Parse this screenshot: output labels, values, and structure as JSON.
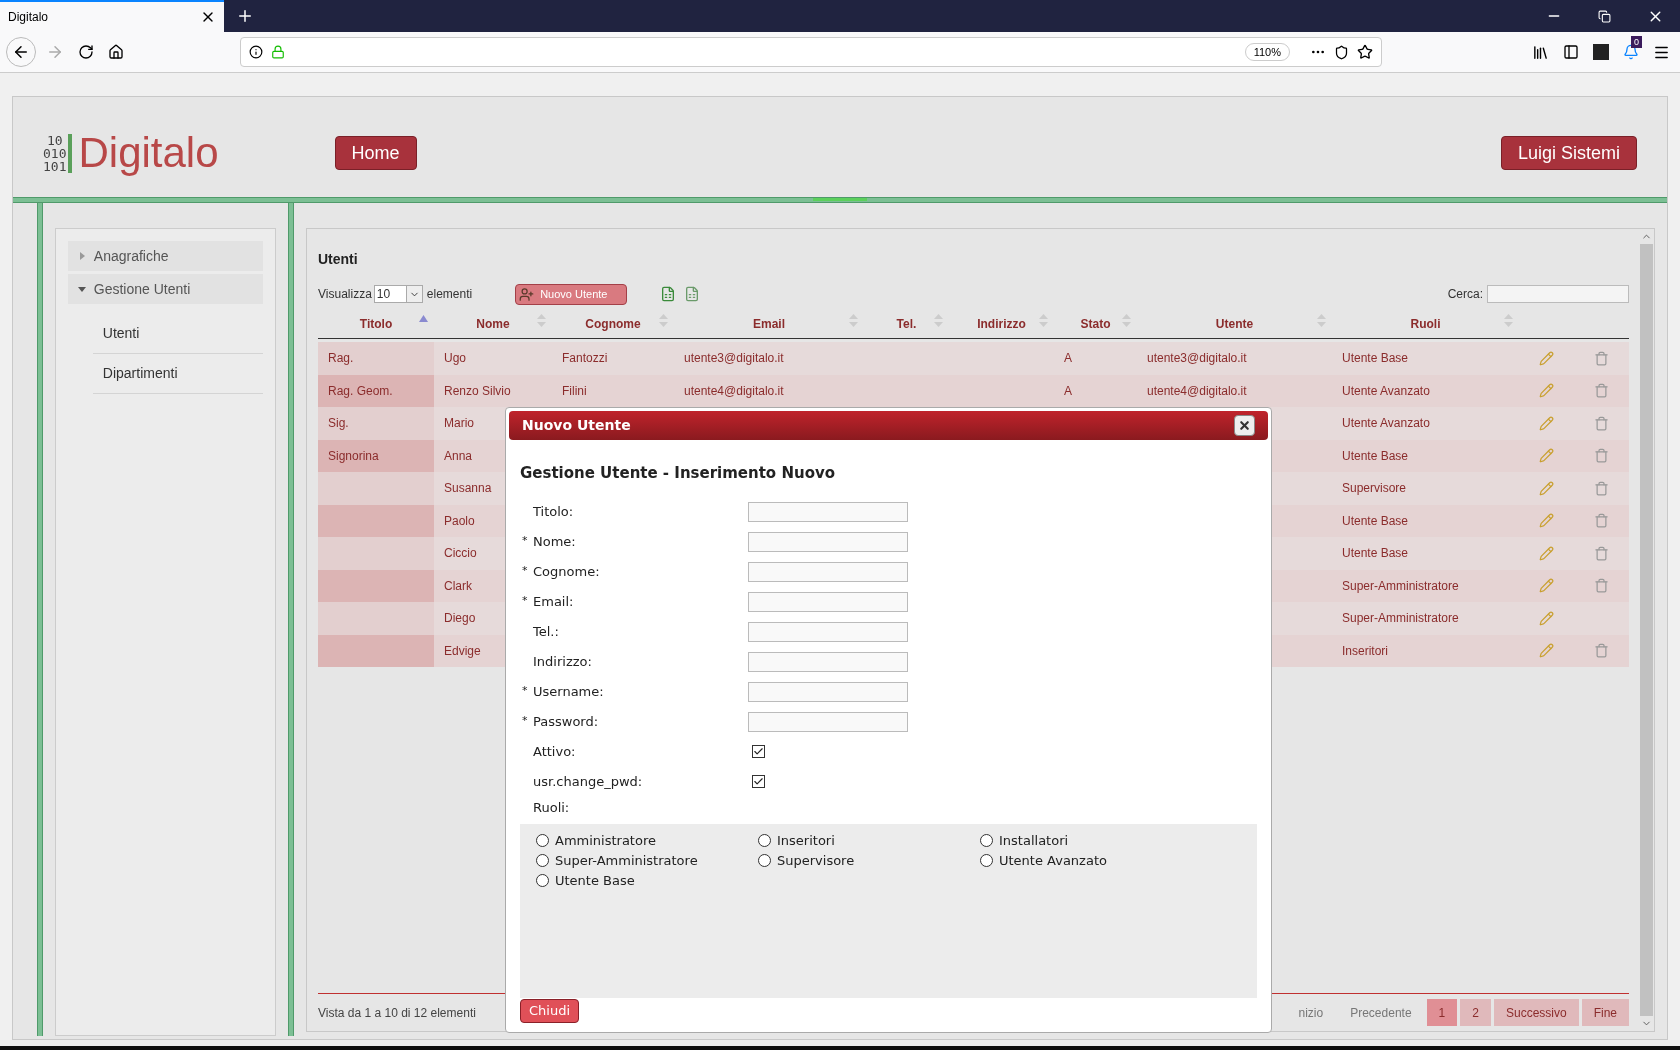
{
  "browser": {
    "tab_title": "Digitalo",
    "zoom": "110%",
    "badge": "0"
  },
  "header": {
    "logo_bits": [
      "10",
      "010",
      "101"
    ],
    "logo_text": "Digitalo",
    "home_button": "Home",
    "user_button": "Luigi Sistemi"
  },
  "sidebar": {
    "groups": [
      {
        "label": "Anagrafiche",
        "expanded": false
      },
      {
        "label": "Gestione Utenti",
        "expanded": true,
        "children": [
          {
            "label": "Utenti"
          },
          {
            "label": "Dipartimenti"
          }
        ]
      }
    ]
  },
  "table": {
    "title": "Utenti",
    "show_label": "Visualizza",
    "page_size": "10",
    "elements_label": "elementi",
    "new_button": "Nuovo Utente",
    "search_label": "Cerca:",
    "columns": [
      {
        "label": "Titolo",
        "sorted": true
      },
      {
        "label": "Nome",
        "sorted": false
      },
      {
        "label": "Cognome",
        "sorted": false
      },
      {
        "label": "Email",
        "sorted": false
      },
      {
        "label": "Tel.",
        "sorted": false
      },
      {
        "label": "Indirizzo",
        "sorted": false
      },
      {
        "label": "Stato",
        "sorted": false
      },
      {
        "label": "Utente",
        "sorted": false
      },
      {
        "label": "Ruoli",
        "sorted": false
      }
    ],
    "rows": [
      {
        "titolo": "Rag.",
        "nome": "Ugo",
        "cognome": "Fantozzi",
        "email": "utente3@digitalo.it",
        "stato": "A",
        "utente": "utente3@digitalo.it",
        "ruoli": "Utente Base",
        "deletable": true
      },
      {
        "titolo": "Rag. Geom.",
        "nome": "Renzo Silvio",
        "cognome": "Filini",
        "email": "utente4@digitalo.it",
        "stato": "A",
        "utente": "utente4@digitalo.it",
        "ruoli": "Utente Avanzato",
        "deletable": true
      },
      {
        "titolo": "Sig.",
        "nome": "Mario",
        "ruoli": "Utente Avanzato",
        "deletable": true
      },
      {
        "titolo": "Signorina",
        "nome": "Anna",
        "ruoli": "Utente Base",
        "deletable": true
      },
      {
        "nome": "Susanna",
        "ruoli": "Supervisore",
        "deletable": true
      },
      {
        "nome": "Paolo",
        "ruoli": "Utente Base",
        "deletable": true
      },
      {
        "nome": "Ciccio",
        "ruoli": "Utente Base",
        "deletable": true
      },
      {
        "nome": "Clark",
        "ruoli": "Super-Amministratore",
        "deletable": true
      },
      {
        "nome": "Diego",
        "ruoli": "Super-Amministratore",
        "deletable": false
      },
      {
        "nome": "Edvige",
        "ruoli": "Inseritori",
        "deletable": true
      }
    ],
    "footer_info": "Vista da 1 a 10 di 12 elementi",
    "pagination": [
      {
        "label": "nizio",
        "kind": "link"
      },
      {
        "label": "Precedente",
        "kind": "link"
      },
      {
        "label": "1",
        "kind": "page",
        "selected": true
      },
      {
        "label": "2",
        "kind": "page",
        "selected": false
      },
      {
        "label": "Successivo",
        "kind": "page",
        "selected": false
      },
      {
        "label": "Fine",
        "kind": "page",
        "selected": false
      }
    ]
  },
  "modal": {
    "title": "Nuovo Utente",
    "heading": "Gestione Utente - Inserimento Nuovo",
    "fields": [
      {
        "label": "Titolo:",
        "kind": "text"
      },
      {
        "asterisk": "*",
        "label": "Nome:",
        "kind": "text"
      },
      {
        "asterisk": "*",
        "label": "Cognome:",
        "kind": "text"
      },
      {
        "asterisk": "*",
        "label": "Email:",
        "kind": "text"
      },
      {
        "label": "Tel.:",
        "kind": "text"
      },
      {
        "label": "Indirizzo:",
        "kind": "text"
      },
      {
        "asterisk": "*",
        "label": "Username:",
        "kind": "text"
      },
      {
        "asterisk": "*",
        "label": "Password:",
        "kind": "text"
      },
      {
        "label": "Attivo:",
        "kind": "checkbox",
        "checked": true
      },
      {
        "label": "usr.change_pwd:",
        "kind": "checkbox",
        "checked": true
      }
    ],
    "roles_label": "Ruoli:",
    "roles": [
      {
        "label": "Amministratore",
        "selected": false
      },
      {
        "label": "Inseritori",
        "selected": false
      },
      {
        "label": "Installatori",
        "selected": false
      },
      {
        "label": "Super-Amministratore",
        "selected": false
      },
      {
        "label": "Supervisore",
        "selected": false
      },
      {
        "label": "Utente Avanzato",
        "selected": false
      },
      {
        "label": "Utente Base",
        "selected": false
      }
    ],
    "close_button": "Chiudi"
  }
}
